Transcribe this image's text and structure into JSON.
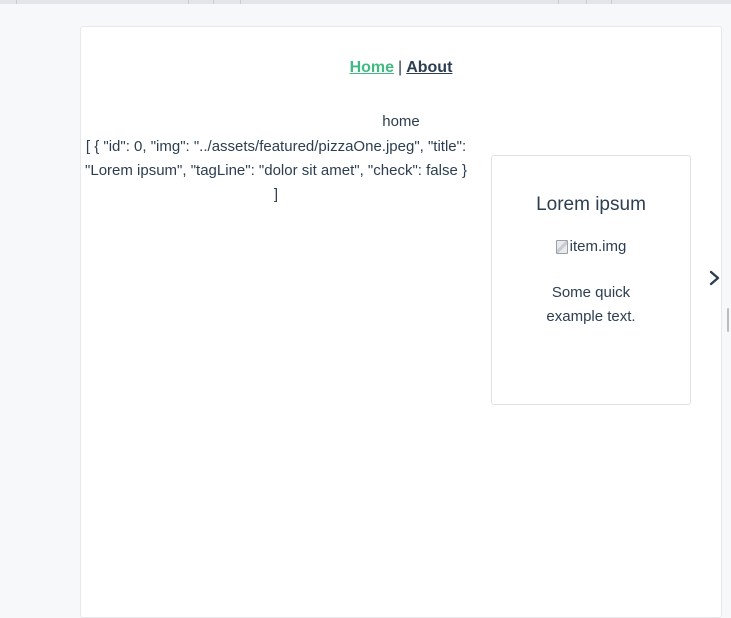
{
  "nav": {
    "home_label": "Home",
    "separator": "|",
    "about_label": "About"
  },
  "page": {
    "heading": "home",
    "json_dump": "[ { \"id\": 0, \"img\": \"../assets/featured/pizzaOne.jpeg\", \"title\": \"Lorem ipsum\", \"tagLine\": \"dolor sit amet\", \"check\": false } ]"
  },
  "card": {
    "title": "Lorem ipsum",
    "img_alt": "item.img",
    "text": "Some quick example text."
  },
  "icons": {
    "next": "chevron-right-icon",
    "broken_image": "broken-image-icon"
  },
  "colors": {
    "active_link": "#42b983",
    "text": "#2c3e50"
  }
}
